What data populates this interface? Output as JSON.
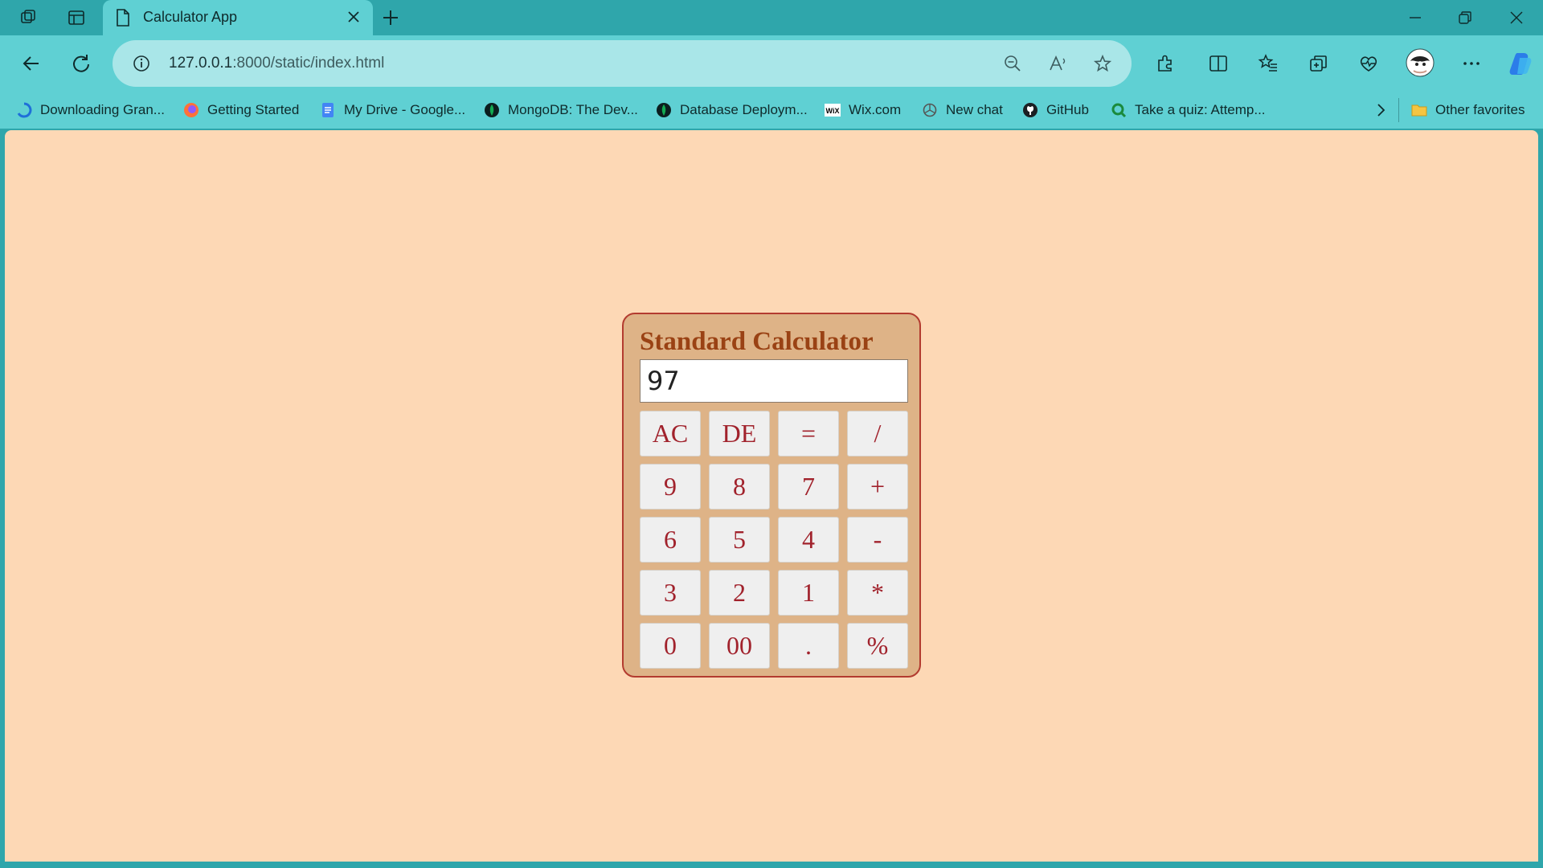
{
  "browser": {
    "tab_title": "Calculator App",
    "url_host": "127.0.0.1",
    "url_path": ":8000/static/index.html",
    "accent_color": "#5fd0d3",
    "frame_color": "#2fa6ab"
  },
  "bookmarks": {
    "items": [
      {
        "label": "Downloading Gran...",
        "icon": "downloading-icon"
      },
      {
        "label": "Getting Started",
        "icon": "firefox-icon"
      },
      {
        "label": "My Drive - Google...",
        "icon": "google-docs-icon"
      },
      {
        "label": "MongoDB: The Dev...",
        "icon": "mongodb-icon"
      },
      {
        "label": "Database Deploym...",
        "icon": "mongodb-icon"
      },
      {
        "label": "Wix.com",
        "icon": "wix-icon"
      },
      {
        "label": "New chat",
        "icon": "openai-icon"
      },
      {
        "label": "GitHub",
        "icon": "github-icon"
      },
      {
        "label": "Take a quiz: Attemp...",
        "icon": "quiz-icon"
      }
    ],
    "other_favorites": "Other favorites"
  },
  "calculator": {
    "title": "Standard Calculator",
    "display_value": "97",
    "keys": [
      [
        "AC",
        "DE",
        "=",
        "/"
      ],
      [
        "9",
        "8",
        "7",
        "+"
      ],
      [
        "6",
        "5",
        "4",
        "-"
      ],
      [
        "3",
        "2",
        "1",
        "*"
      ],
      [
        "0",
        "00",
        ".",
        "%"
      ]
    ],
    "background_color": "#fdd8b5",
    "panel_color": "#deb387",
    "title_color": "#9a4214",
    "key_text_color": "#a1222c"
  }
}
